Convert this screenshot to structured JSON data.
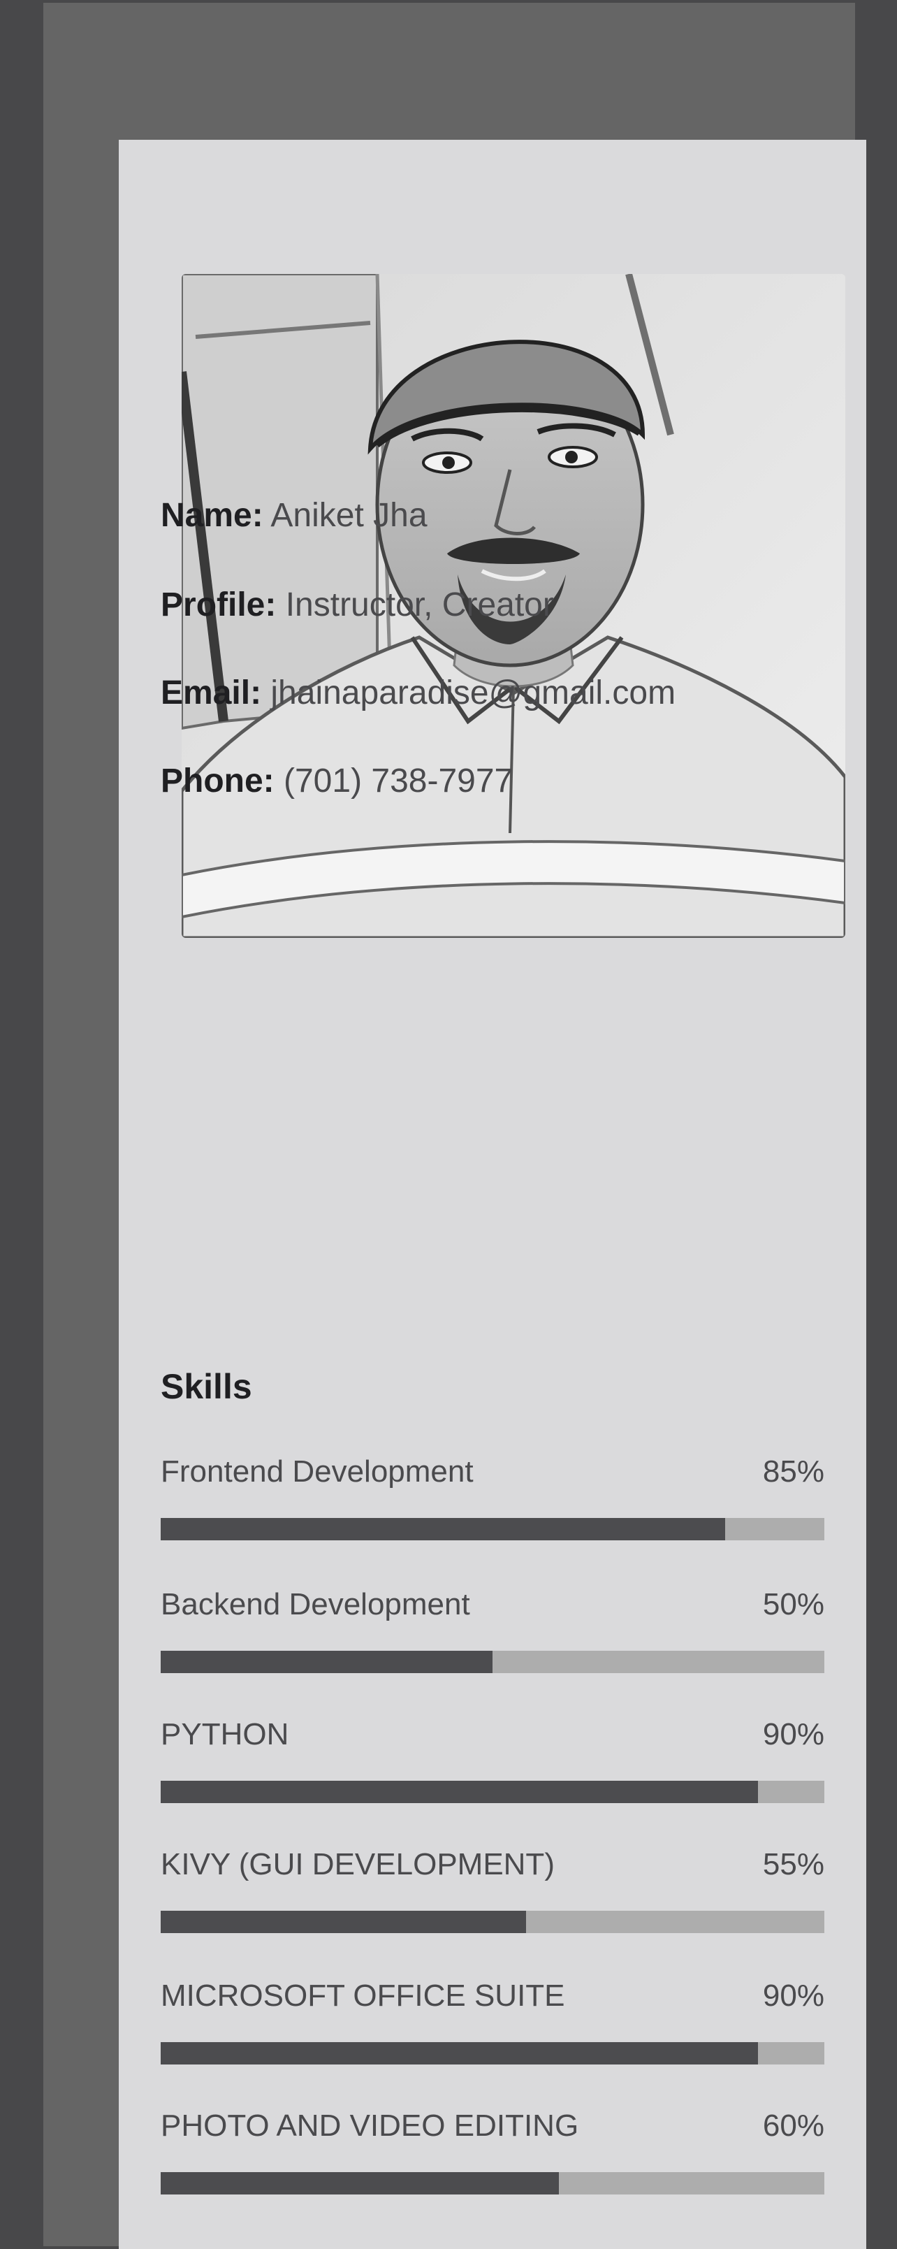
{
  "profile": {
    "name_label": "Name:",
    "name_value": "Aniket Jha",
    "profile_label": "Profile:",
    "profile_value": "Instructor, Creator",
    "email_label": "Email:",
    "email_value": "jhainaparadise@gmail.com",
    "phone_label": "Phone:",
    "phone_value": "(701) 738-7977"
  },
  "skills": {
    "heading": "Skills",
    "items": [
      {
        "name": "Frontend Development",
        "percent": "85%",
        "value": 85
      },
      {
        "name": "Backend Development",
        "percent": "50%",
        "value": 50
      },
      {
        "name": "PYTHON",
        "percent": "90%",
        "value": 90
      },
      {
        "name": "KIVY (GUI DEVELOPMENT)",
        "percent": "55%",
        "value": 55
      },
      {
        "name": "MICROSOFT OFFICE SUITE",
        "percent": "90%",
        "value": 90
      },
      {
        "name": "PHOTO AND VIDEO EDITING",
        "percent": "60%",
        "value": 60
      }
    ]
  },
  "colors": {
    "page_bg": "#48484a",
    "panel_bg": "#656565",
    "card_bg": "#dadadc",
    "bar_fill": "#4c4c4f",
    "bar_track": "#adadad"
  },
  "photo": {
    "icon": "profile-portrait-sketch"
  }
}
